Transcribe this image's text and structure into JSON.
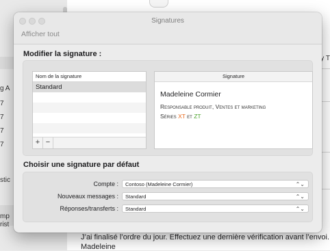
{
  "window": {
    "title": "Signatures",
    "show_all": "Afficher tout"
  },
  "background": {
    "left_labels": [
      "g A",
      "7",
      "7",
      "7",
      "7",
      "stic",
      "mp",
      "rist"
    ],
    "top_text": "...............................",
    "right_edge": "y T",
    "bottom_lines": [
      "J’ai finalisé l’ordre du jour. Effectuez une dernière vérification avant l’envoi.",
      "Madeleine"
    ]
  },
  "edit_section": {
    "title": "Modifier la signature :",
    "list_header": "Nom de la signature",
    "signatures": [
      "Standard"
    ],
    "add_label": "+",
    "remove_label": "−",
    "preview_header": "Signature",
    "preview": {
      "name": "Madeleine Cormier",
      "role": "Responsable produit, Ventes et marketing",
      "series_prefix": "Séries",
      "series_a": "XT",
      "series_and": "et",
      "series_b": "ZT",
      "color_a": "#e8681c",
      "color_b": "#4aa12b"
    }
  },
  "default_section": {
    "title": "Choisir une signature par défaut",
    "rows": [
      {
        "label": "Compte :",
        "value": "Contoso (Madeleine Cormier)"
      },
      {
        "label": "Nouveaux messages :",
        "value": "Standard"
      },
      {
        "label": "Réponses/transferts :",
        "value": "Standard"
      }
    ],
    "chevron": "⌃⌄"
  }
}
